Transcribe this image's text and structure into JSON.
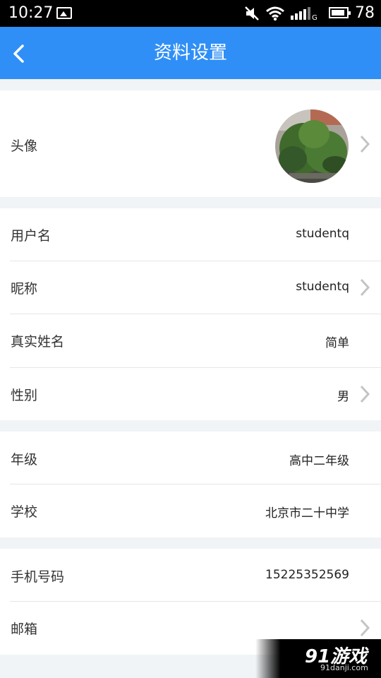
{
  "status_bar": {
    "time": "10:27",
    "battery": "78"
  },
  "header": {
    "title": "资料设置"
  },
  "profile": {
    "avatar": {
      "label": "头像"
    },
    "username": {
      "label": "用户名",
      "value": "studentq"
    },
    "nickname": {
      "label": "昵称",
      "value": "studentq"
    },
    "real_name": {
      "label": "真实姓名",
      "value": "简单"
    },
    "gender": {
      "label": "性别",
      "value": "男"
    },
    "grade": {
      "label": "年级",
      "value": "高中二年级"
    },
    "school": {
      "label": "学校",
      "value": "北京市二十中学"
    },
    "phone": {
      "label": "手机号码",
      "value": "15225352569"
    },
    "email": {
      "label": "邮箱",
      "value": ""
    }
  },
  "watermark": {
    "brand": "91游戏",
    "site": "91danji.com"
  },
  "colors": {
    "header_bg": "#2f8ff6",
    "page_bg": "#f1f4f6",
    "row_bg": "#ffffff",
    "divider": "#e6e6e6",
    "arrow": "#c4c4c4"
  }
}
